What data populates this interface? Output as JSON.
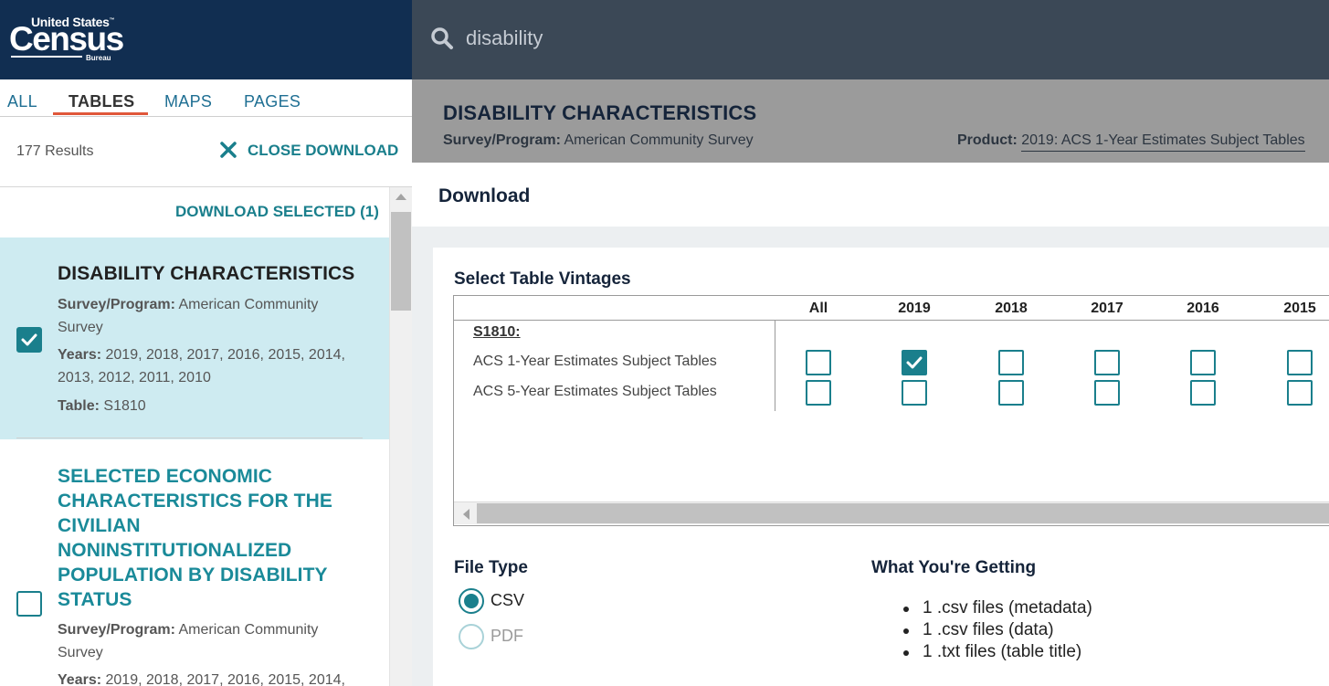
{
  "logo": {
    "line1": "United States",
    "trademark": "™",
    "line2": "Census",
    "line3": "Bureau"
  },
  "tabs": [
    {
      "label": "ALL"
    },
    {
      "label": "TABLES"
    },
    {
      "label": "MAPS"
    },
    {
      "label": "PAGES"
    }
  ],
  "active_tab": "TABLES",
  "results": {
    "count": "177 Results",
    "close_download": "CLOSE DOWNLOAD",
    "download_selected": "DOWNLOAD SELECTED (1)",
    "items": [
      {
        "title": "DISABILITY CHARACTERISTICS",
        "survey_label": "Survey/Program:",
        "survey_value": "American Community Survey",
        "years_label": "Years:",
        "years_value": "2019, 2018, 2017, 2016, 2015, 2014, 2013, 2012, 2011, 2010",
        "table_label": "Table:",
        "table_value": "S1810",
        "checked": true
      },
      {
        "title": "SELECTED ECONOMIC CHARACTERISTICS FOR THE CIVILIAN NONINSTITUTIONALIZED POPULATION BY DISABILITY STATUS",
        "survey_label": "Survey/Program:",
        "survey_value": "American Community Survey",
        "years_label": "Years:",
        "years_value": "2019, 2018, 2017, 2016, 2015, 2014,",
        "checked": false
      }
    ]
  },
  "search": {
    "value": "disability"
  },
  "table_header": {
    "title": "DISABILITY CHARACTERISTICS",
    "survey_label": "Survey/Program:",
    "survey_value": "American Community Survey",
    "product_label": "Product:",
    "product_value": "2019: ACS 1-Year Estimates Subject Tables"
  },
  "download": {
    "title": "Download",
    "vintages_label": "Select Table Vintages",
    "columns": [
      "All",
      "2019",
      "2018",
      "2017",
      "2016",
      "2015"
    ],
    "table_code": "S1810:",
    "rows": [
      {
        "label": "ACS 1-Year Estimates Subject Tables",
        "checked": [
          false,
          true,
          false,
          false,
          false,
          false
        ]
      },
      {
        "label": "ACS 5-Year Estimates Subject Tables",
        "checked": [
          false,
          false,
          false,
          false,
          false,
          false
        ]
      }
    ],
    "file_type_label": "File Type",
    "file_types": [
      {
        "label": "CSV",
        "selected": true,
        "enabled": true
      },
      {
        "label": "PDF",
        "selected": false,
        "enabled": false
      }
    ],
    "getting_label": "What You're Getting",
    "getting_items": [
      "1 .csv files (metadata)",
      "1 .csv files (data)",
      "1 .txt files (table title)"
    ]
  },
  "colors": {
    "header_navy": "#112e51",
    "search_bar": "#3b4856",
    "accent_teal": "#1a7f8c",
    "tab_underline": "#e0573a",
    "selected_row_bg": "#ceebf1",
    "table_header_bg": "#9b9b9b"
  },
  "icons": {
    "search": "search-icon",
    "close": "close-icon",
    "check": "checkmark-icon"
  }
}
